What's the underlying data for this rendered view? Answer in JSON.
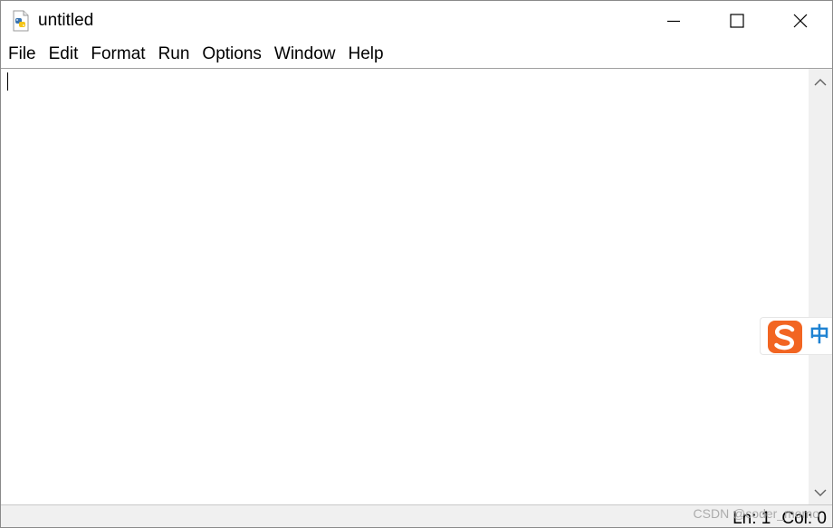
{
  "window": {
    "title": "untitled",
    "app_icon": "python-file-icon",
    "controls": {
      "minimize": "minimize-icon",
      "maximize": "maximize-icon",
      "close": "close-icon"
    }
  },
  "menu": {
    "items": [
      {
        "label": "File"
      },
      {
        "label": "Edit"
      },
      {
        "label": "Format"
      },
      {
        "label": "Run"
      },
      {
        "label": "Options"
      },
      {
        "label": "Window"
      },
      {
        "label": "Help"
      }
    ]
  },
  "editor": {
    "content": ""
  },
  "status": {
    "line": "Ln: 1",
    "col": "Col: 0"
  },
  "ime": {
    "logo": "sogou-s-icon",
    "mode": "中",
    "accent": "#f26522",
    "mode_color": "#1e82d2"
  },
  "watermark": {
    "text": "CSDN @coder_momo"
  }
}
